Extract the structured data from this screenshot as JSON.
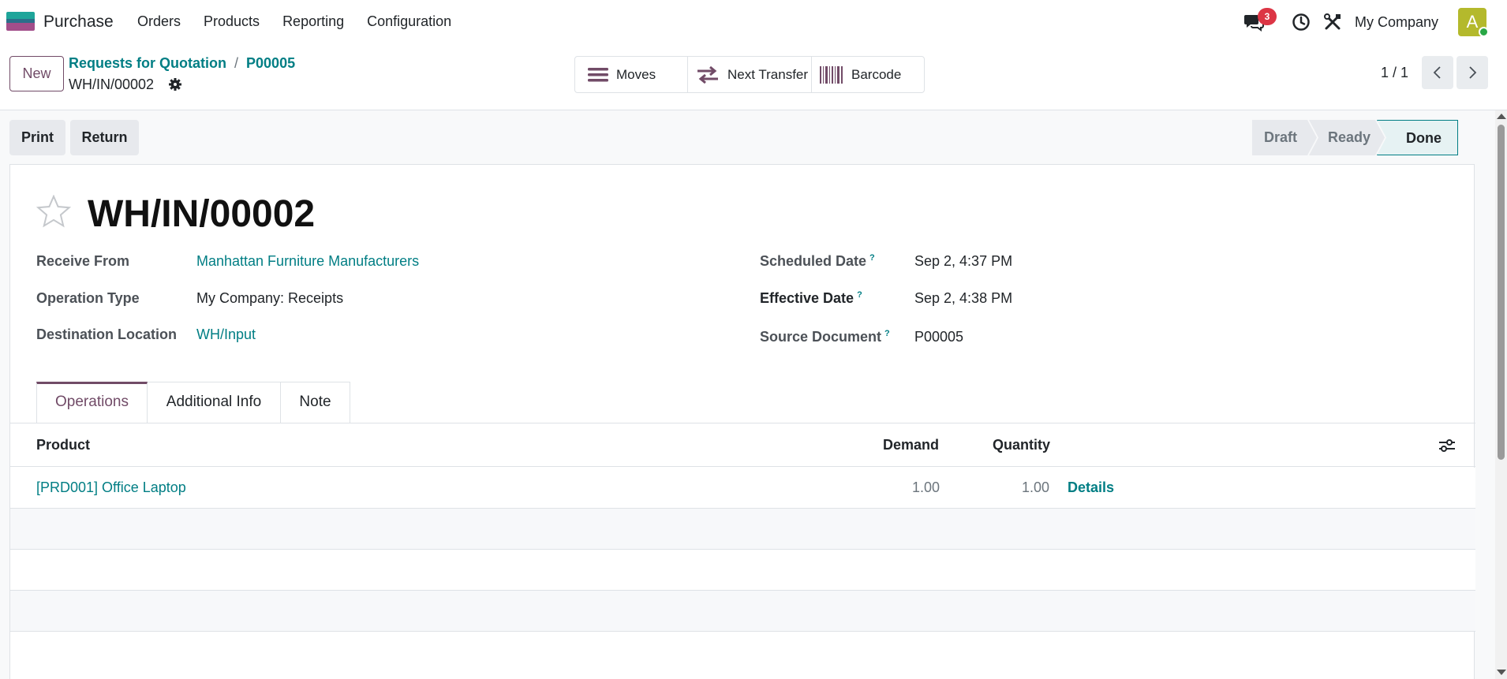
{
  "navbar": {
    "app_name": "Purchase",
    "menu": [
      "Orders",
      "Products",
      "Reporting",
      "Configuration"
    ],
    "messages_count": "3",
    "company": "My Company",
    "avatar_letter": "A"
  },
  "control": {
    "new_label": "New",
    "breadcrumb": [
      "Requests for Quotation",
      "P00005"
    ],
    "record_name": "WH/IN/00002",
    "smart_buttons": [
      {
        "label": "Moves",
        "icon": "list-icon"
      },
      {
        "label": "Next Transfer",
        "icon": "transfer-arrows-icon"
      },
      {
        "label": "Barcode",
        "icon": "barcode-icon"
      }
    ],
    "pager": "1 / 1"
  },
  "actions": {
    "print": "Print",
    "return": "Return"
  },
  "statusbar": {
    "stages": [
      "Draft",
      "Ready",
      "Done"
    ],
    "current": "Done"
  },
  "form": {
    "title": "WH/IN/00002",
    "fields_left": [
      {
        "label": "Receive From",
        "value": "Manhattan Furniture Manufacturers",
        "link": true
      },
      {
        "label": "Operation Type",
        "value": "My Company: Receipts",
        "link": false
      },
      {
        "label": "Destination Location",
        "value": "WH/Input",
        "link": true
      }
    ],
    "fields_right": [
      {
        "label": "Scheduled Date",
        "help": "?",
        "value": "Sep 2, 4:37 PM"
      },
      {
        "label": "Effective Date",
        "help": "?",
        "value": "Sep 2, 4:38 PM"
      },
      {
        "label": "Source Document",
        "help": "?",
        "value": "P00005"
      }
    ]
  },
  "tabs": [
    "Operations",
    "Additional Info",
    "Note"
  ],
  "table": {
    "headers": [
      "Product",
      "Demand",
      "Quantity"
    ],
    "rows": [
      {
        "product": "[PRD001] Office Laptop",
        "demand": "1.00",
        "quantity": "1.00",
        "details": "Details"
      }
    ]
  },
  "colors": {
    "brand": "#714b67",
    "link": "#017e84",
    "badge": "#dc3545",
    "avatar": "#b4b92c"
  }
}
